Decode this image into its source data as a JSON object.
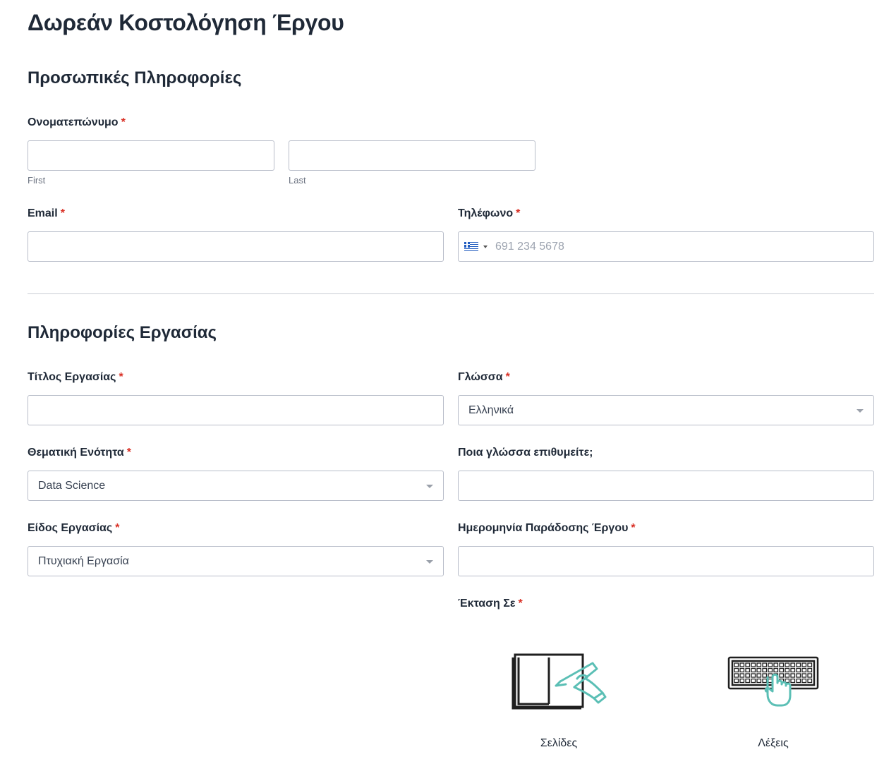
{
  "form": {
    "title": "Δωρεάν Κοστολόγηση Έργου"
  },
  "personal": {
    "section_title": "Προσωπικές Πληροφορίες",
    "fullname_label": "Ονοματεπώνυμο",
    "first_value": "",
    "last_value": "",
    "first_sublabel": "First",
    "last_sublabel": "Last",
    "email_label": "Email",
    "email_value": "",
    "phone_label": "Τηλέφωνο",
    "phone_placeholder": "691 234 5678",
    "required_mark": "*"
  },
  "work": {
    "section_title": "Πληροφορίες Εργασίας",
    "title_label": "Τίτλος Εργασίας",
    "title_value": "",
    "language_label": "Γλώσσα",
    "language_selected": "Ελληνικά",
    "subject_label": "Θεματική Ενότητα",
    "subject_selected": "Data Science",
    "other_language_label": "Ποια γλώσσα επιθυμείτε;",
    "other_language_value": "",
    "type_label": "Είδος Εργασίας",
    "type_selected": "Πτυχιακή Εργασία",
    "deadline_label": "Ημερομηνία Παράδοσης Έργου",
    "deadline_value": "",
    "extent_label": "Έκταση Σε",
    "extent_options": [
      {
        "label": "Σελίδες",
        "icon": "book-pen-icon"
      },
      {
        "label": "Λέξεις",
        "icon": "keyboard-hand-icon"
      }
    ]
  },
  "colors": {
    "text": "#1f2937",
    "required": "#d93025",
    "accent_teal": "#5bbfb5",
    "border": "#b8bdc9"
  }
}
